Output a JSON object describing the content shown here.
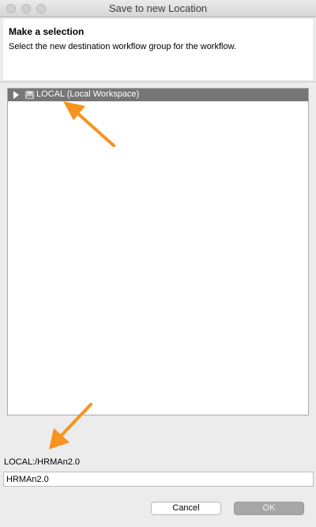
{
  "window": {
    "title": "Save to new Location"
  },
  "banner": {
    "title": "Make a selection",
    "description": "Select the new destination workflow group for the workflow."
  },
  "tree": {
    "items": [
      {
        "label": "LOCAL (Local Workspace)",
        "icon": "workspace-icon",
        "expanded": false,
        "selected": true
      }
    ]
  },
  "destination": {
    "path": "LOCAL:/HRMAn2.0",
    "name_value": "HRMAn2.0"
  },
  "buttons": {
    "cancel": "Cancel",
    "ok": "OK"
  },
  "annotations": {
    "arrow_color": "#f7931e"
  },
  "colors": {
    "selection": "#767676",
    "ok_disabled": "#a7a7a7"
  }
}
